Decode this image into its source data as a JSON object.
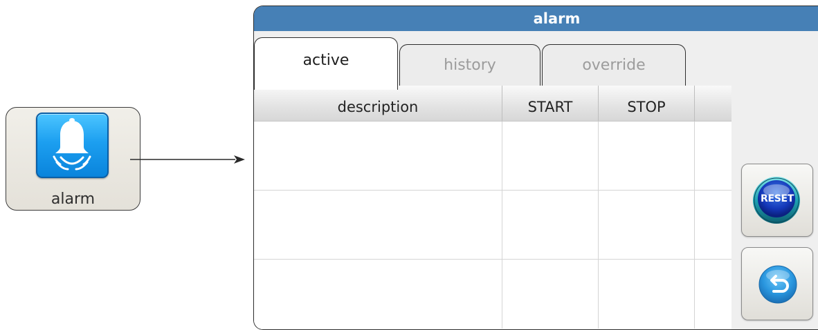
{
  "launcher": {
    "label": "alarm",
    "icon": "bell-icon"
  },
  "window": {
    "title": "alarm",
    "tabs": [
      {
        "label": "active",
        "selected": true
      },
      {
        "label": "history",
        "selected": false
      },
      {
        "label": "override",
        "selected": false
      }
    ],
    "table": {
      "columns": [
        "description",
        "START",
        "STOP",
        ""
      ],
      "rows": [
        [
          "",
          "",
          "",
          ""
        ],
        [
          "",
          "",
          "",
          ""
        ],
        [
          "",
          "",
          "",
          ""
        ]
      ]
    },
    "buttons": {
      "reset_label": "RESET",
      "reset_icon": "reset-icon",
      "back_icon": "undo-icon"
    }
  },
  "colors": {
    "titlebar": "#4680b6",
    "icon_blue": "#1c9ff0"
  }
}
